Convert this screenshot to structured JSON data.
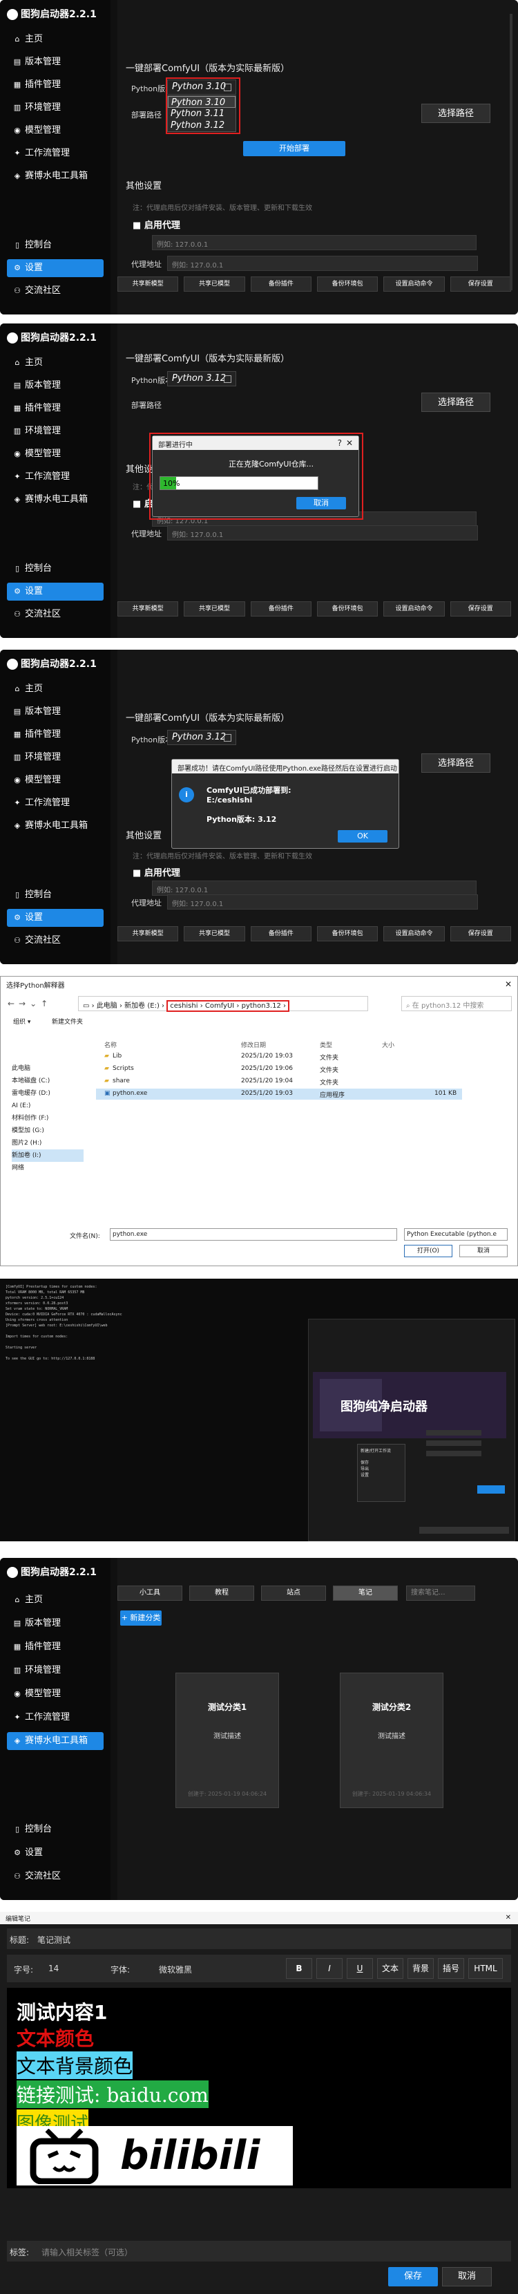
{
  "app": {
    "title": "图狗启动器2.2.1",
    "nav": [
      "主页",
      "版本管理",
      "插件管理",
      "环境管理",
      "模型管理",
      "工作流管理",
      "赛博水电工具箱"
    ],
    "nav_icons": [
      "home-icon",
      "version-icon",
      "plugin-icon",
      "environment-icon",
      "model-icon",
      "workflow-icon",
      "toolbox-icon"
    ],
    "nav_bottom": [
      "控制台",
      "设置",
      "交流社区"
    ],
    "nav_bottom_icons": [
      "console-icon",
      "settings-icon",
      "community-icon"
    ]
  },
  "settings": {
    "deploy_title": "一键部署ComfyUI（版本为实际最新版）",
    "python_label": "Python版本",
    "deploy_path_label": "部署路径",
    "browse_label": "选择路径",
    "start_label": "开始部署",
    "other_title": "其他设置",
    "note1": "注：代理启用后仅对插件安装、版本管理、更新和下载生效",
    "proxy_enable": "启用代理",
    "proxy_note": "注：代理启用后仅对插件安装、版本管理、更新和下载生效",
    "proxy_addr_label": "代理地址",
    "proxy_placeholder": "例如: 127.0.0.1",
    "bottom_buttons": [
      "共享新模型",
      "共享已模型",
      "备份插件",
      "备份环境包",
      "设置启动命令",
      "保存设置"
    ]
  },
  "panel1": {
    "python_selected": "Python 3.10",
    "dropdown": [
      "Python 3.10",
      "Python 3.11",
      "Python 3.12"
    ]
  },
  "panel2": {
    "python_selected": "Python 3.12",
    "dialog_title": "部署进行中",
    "dialog_help": "?",
    "dialog_msg": "正在克隆ComfyUI仓库...",
    "progress": "10%",
    "progress_value": 0.1,
    "cancel": "取消"
  },
  "panel3": {
    "python_selected": "Python 3.12",
    "dialog_title": "部署成功！请在ComfyUI路径使用Python.exe路径然后在设置进行启动",
    "dialog_msg1": "ComfyUI已成功部署到:",
    "dialog_msg2": "E:/ceshishi",
    "dialog_msg3": "Python版本: 3.12",
    "ok": "OK"
  },
  "filedialog": {
    "title": "选择Python解释器",
    "path_parts": [
      "此电脑",
      "新加卷 (E:)",
      "ceshishi",
      "ComfyUI",
      "python3.12"
    ],
    "search_placeholder": "在 python3.12 中搜索",
    "organize": "组织 ▾",
    "new_folder": "新建文件夹",
    "headers": [
      "名称",
      "修改日期",
      "类型",
      "大小"
    ],
    "tree": [
      "此电脑",
      "本地磁盘 (C:)",
      "雷电缓存 (D:)",
      "AI (E:)",
      "材料创作 (F:)",
      "模型加 (G:)",
      "图片2 (H:)",
      "新加卷 (I:)",
      "网络"
    ],
    "files": [
      {
        "name": "Lib",
        "date": "2025/1/20 19:03",
        "type": "文件夹",
        "size": ""
      },
      {
        "name": "Scripts",
        "date": "2025/1/20 19:06",
        "type": "文件夹",
        "size": ""
      },
      {
        "name": "share",
        "date": "2025/1/20 19:04",
        "type": "文件夹",
        "size": ""
      },
      {
        "name": "python.exe",
        "date": "2025/1/20 19:03",
        "type": "应用程序",
        "size": "101 KB"
      }
    ],
    "filename_label": "文件名(N):",
    "filename": "python.exe",
    "filter": "Python Executable (python.e",
    "open": "打开(O)",
    "cancel": "取消"
  },
  "terminal": {
    "lines": [
      "[ComfyUI] Prestartup times for custom nodes:",
      "Total VRAM 8000 MB, total RAM 65357 MB",
      "pytorch version: 2.5.1+cu124",
      "xformers version: 0.0.28.post3",
      "Set vram state to: NORMAL_VRAM",
      "Device: cuda:0 NVIDIA GeForce RTX 4070 : cudaMallocAsync",
      "Using xformers cross attention",
      "[Prompt Server] web root: E:\\ceshishi\\ComfyUI\\web",
      "Import times for custom nodes:",
      "Starting server",
      "To see the GUI go to: http://127.0.0.1:8188"
    ],
    "banner": "图狗纯净启动器",
    "menu": [
      "新建/打开工作流",
      "保存",
      "导出",
      "设置"
    ]
  },
  "notes": {
    "tabs": [
      "小工具",
      "教程",
      "站点",
      "笔记"
    ],
    "search_placeholder": "搜索笔记...",
    "add_category": "+ 新建分类",
    "cards": [
      {
        "title": "测试分类1",
        "desc": "测试描述",
        "meta": "创建于: 2025-01-19 04:06:24"
      },
      {
        "title": "测试分类2",
        "desc": "测试描述",
        "meta": "创建于: 2025-01-19 04:06:34"
      }
    ]
  },
  "editor": {
    "window_title": "编辑笔记",
    "title_label": "标题:",
    "title_value": "笔记测试",
    "size_label": "字号:",
    "size_value": "14",
    "font_label": "字体:",
    "font_value": "微软雅黑",
    "tools": [
      "B",
      "I",
      "U",
      "文本",
      "背景",
      "插号",
      "HTML"
    ],
    "line1": "测试内容1",
    "line2": "文本颜色",
    "line3": "文本背景颜色",
    "line4": "链接测试: baidu.com",
    "line5": "图像测试",
    "logo_text": "bilibili",
    "tags_label": "标签:",
    "tags_placeholder": "请输入相关标签（可选）",
    "save": "保存",
    "cancel": "取消"
  },
  "colors": {
    "accent": "#1e88e5",
    "highlight": "#e02020",
    "bg": "#101010"
  }
}
